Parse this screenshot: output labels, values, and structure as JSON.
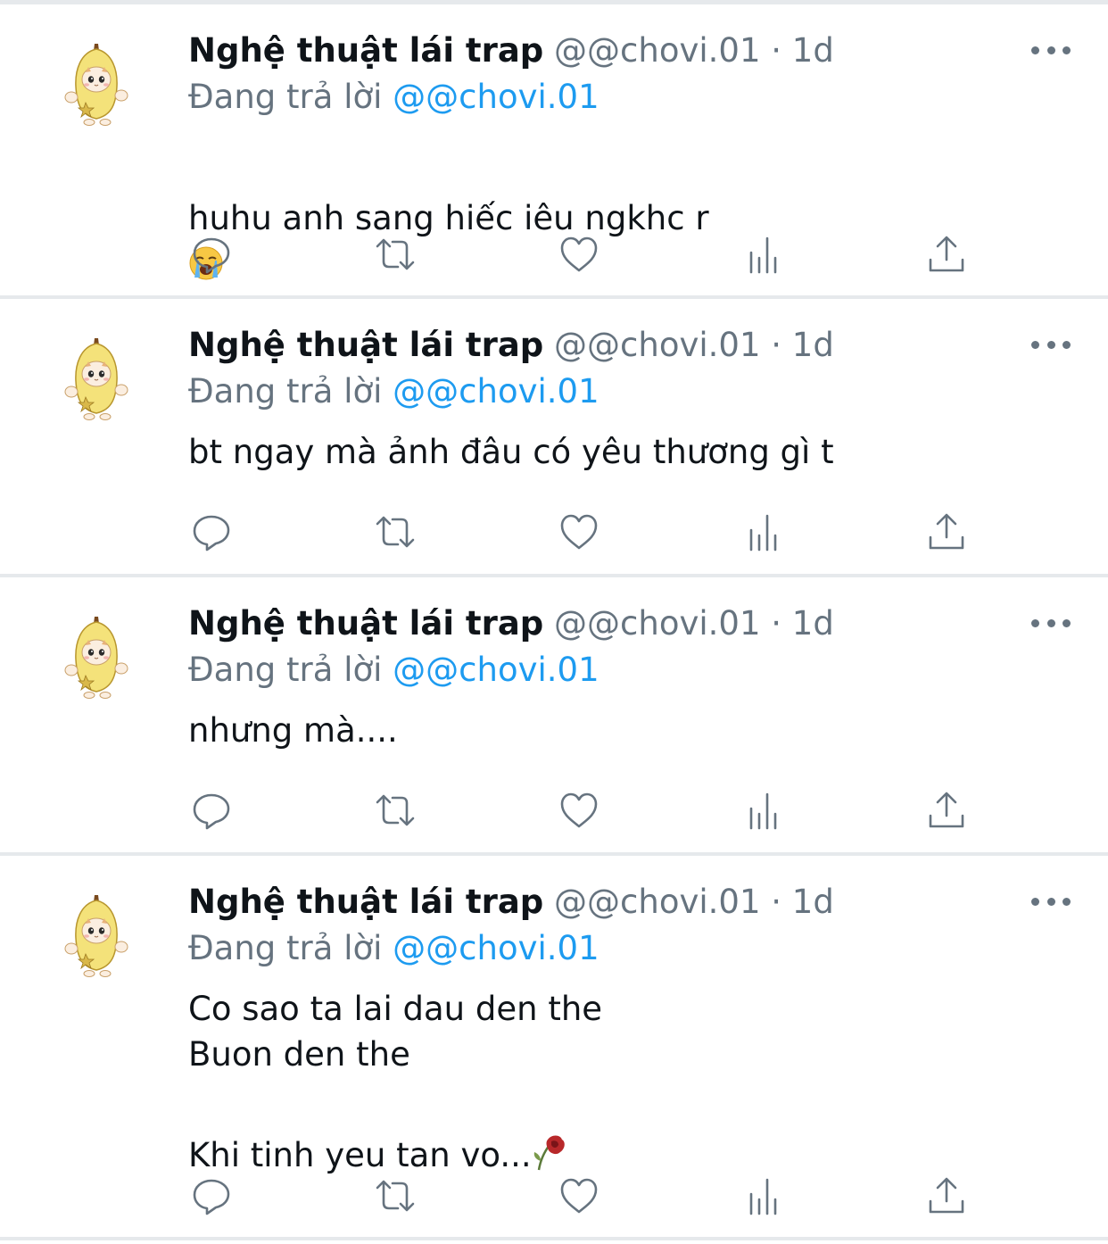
{
  "accent_color": "#1d9bf0",
  "muted_color": "#66737f",
  "tweets": [
    {
      "display_name": "Nghệ thuật lái trap",
      "handle": "@@chovi.01",
      "separator": "·",
      "time": "1d",
      "reply_prefix": "Đang trả lời",
      "reply_to": "@@chovi.01",
      "text": "huhu anh sang hiếc iêu ngkhc r",
      "emoji": "loudly-crying-face"
    },
    {
      "display_name": "Nghệ thuật lái trap",
      "handle": "@@chovi.01",
      "separator": "·",
      "time": "1d",
      "reply_prefix": "Đang trả lời",
      "reply_to": "@@chovi.01",
      "text": "bt ngay mà ảnh đâu có yêu thương gì t"
    },
    {
      "display_name": "Nghệ thuật lái trap",
      "handle": "@@chovi.01",
      "separator": "·",
      "time": "1d",
      "reply_prefix": "Đang trả lời",
      "reply_to": "@@chovi.01",
      "text": "nhưng mà...."
    },
    {
      "display_name": "Nghệ thuật lái trap",
      "handle": "@@chovi.01",
      "separator": "·",
      "time": "1d",
      "reply_prefix": "Đang trả lời",
      "reply_to": "@@chovi.01",
      "lines": [
        "Co sao ta lai dau den the",
        "Buon den the",
        "Khi tinh yeu tan vo..."
      ],
      "emoji": "wilted-flower"
    }
  ],
  "action_icons": [
    "reply-icon",
    "retweet-icon",
    "like-icon",
    "analytics-icon",
    "share-icon"
  ]
}
